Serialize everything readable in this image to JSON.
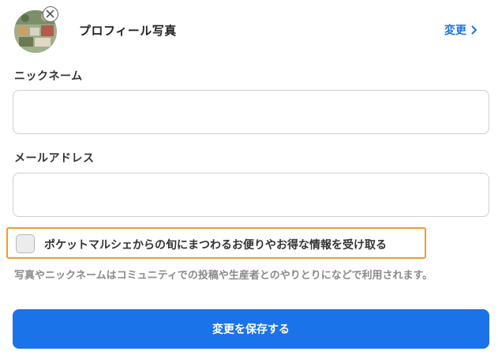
{
  "profile": {
    "title": "プロフィール写真",
    "change_label": "変更"
  },
  "nickname": {
    "label": "ニックネーム",
    "value": "",
    "placeholder": ""
  },
  "email": {
    "label": "メールアドレス",
    "value": "",
    "placeholder": ""
  },
  "optin": {
    "label": "ポケットマルシェからの旬にまつわるお便りやお得な情報を受け取る",
    "checked": false
  },
  "note": "写真やニックネームはコミュニティでの投稿や生産者とのやりとりになどで利用されます。",
  "save_label": "変更を保存する",
  "colors": {
    "accent": "#1a73e8",
    "highlight": "#f39a2b"
  },
  "icons": {
    "remove": "close-circle-icon",
    "chevron": "chevron-right-icon"
  }
}
